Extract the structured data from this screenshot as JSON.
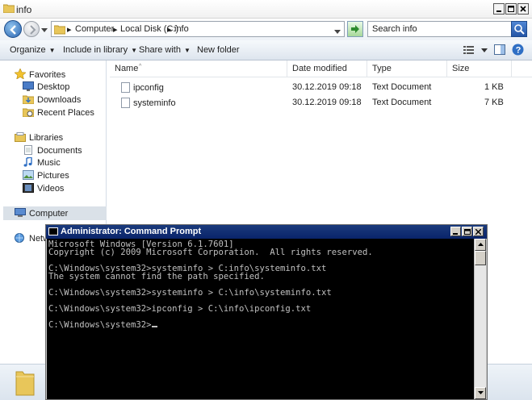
{
  "window": {
    "title": "info"
  },
  "address": {
    "segments": [
      "Computer",
      "Local Disk (C:)",
      "info"
    ],
    "separator": "▸",
    "search_placeholder": "Search info"
  },
  "toolbar": {
    "organize": "Organize",
    "include": "Include in library",
    "share": "Share with",
    "new_folder": "New folder"
  },
  "nav": {
    "favorites": "Favorites",
    "desktop": "Desktop",
    "downloads": "Downloads",
    "recent": "Recent Places",
    "libraries": "Libraries",
    "documents": "Documents",
    "music": "Music",
    "pictures": "Pictures",
    "videos": "Videos",
    "computer": "Computer",
    "network": "Netw"
  },
  "columns": {
    "name": "Name",
    "date": "Date modified",
    "type": "Type",
    "size": "Size"
  },
  "files": [
    {
      "name": "ipconfig",
      "date": "30.12.2019 09:18",
      "type": "Text Document",
      "size": "1 KB"
    },
    {
      "name": "systeminfo",
      "date": "30.12.2019 09:18",
      "type": "Text Document",
      "size": "7 KB"
    }
  ],
  "cmd": {
    "title": "Administrator: Command Prompt",
    "lines": [
      "Microsoft Windows [Version 6.1.7601]",
      "Copyright (c) 2009 Microsoft Corporation.  All rights reserved.",
      "",
      "C:\\Windows\\system32>systeminfo > C:info\\systeminfo.txt",
      "The system cannot find the path specified.",
      "",
      "C:\\Windows\\system32>systeminfo > C:\\info\\systeminfo.txt",
      "",
      "C:\\Windows\\system32>ipconfig > C:\\info\\ipconfig.txt",
      "",
      "C:\\Windows\\system32>"
    ]
  },
  "colors": {
    "accent": "#0a246a",
    "selection": "#dae1e8",
    "folder": "#e8c65a"
  }
}
